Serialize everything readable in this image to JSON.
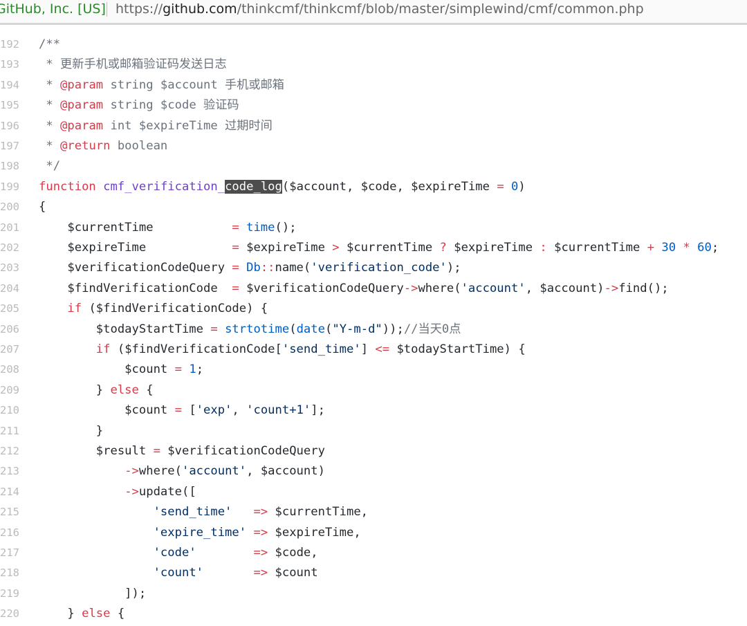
{
  "browser": {
    "site_identity": "GitHub, Inc. [US]",
    "url_scheme": "https://",
    "url_host": "github.com",
    "url_path": "/thinkcmf/thinkcmf/blob/master/simplewind/cmf/common.php"
  },
  "code": {
    "highlighted_text": "code_log",
    "lines": [
      {
        "n": "192",
        "tokens": [
          {
            "t": "/**",
            "c": "c"
          }
        ]
      },
      {
        "n": "193",
        "tokens": [
          {
            "t": " * 更新手机或邮箱验证码发送日志",
            "c": "c"
          }
        ]
      },
      {
        "n": "194",
        "tokens": [
          {
            "t": " * ",
            "c": "c"
          },
          {
            "t": "@param",
            "c": "k"
          },
          {
            "t": " string $account 手机或邮箱",
            "c": "c"
          }
        ]
      },
      {
        "n": "195",
        "tokens": [
          {
            "t": " * ",
            "c": "c"
          },
          {
            "t": "@param",
            "c": "k"
          },
          {
            "t": " string $code 验证码",
            "c": "c"
          }
        ]
      },
      {
        "n": "196",
        "tokens": [
          {
            "t": " * ",
            "c": "c"
          },
          {
            "t": "@param",
            "c": "k"
          },
          {
            "t": " int $expireTime 过期时间",
            "c": "c"
          }
        ]
      },
      {
        "n": "197",
        "tokens": [
          {
            "t": " * ",
            "c": "c"
          },
          {
            "t": "@return",
            "c": "k"
          },
          {
            "t": " boolean",
            "c": "c"
          }
        ]
      },
      {
        "n": "198",
        "tokens": [
          {
            "t": " */",
            "c": "c"
          }
        ]
      },
      {
        "n": "199",
        "tokens": [
          {
            "t": "function",
            "c": "k"
          },
          {
            "t": " "
          },
          {
            "t": "cmf_verification_",
            "c": "f"
          },
          {
            "t": "code_log",
            "c": "hl"
          },
          {
            "t": "($account, $code, $expireTime "
          },
          {
            "t": "=",
            "c": "k"
          },
          {
            "t": " "
          },
          {
            "t": "0",
            "c": "e"
          },
          {
            "t": ")"
          }
        ]
      },
      {
        "n": "200",
        "tokens": [
          {
            "t": "{"
          }
        ]
      },
      {
        "n": "201",
        "tokens": [
          {
            "t": "    $currentTime           "
          },
          {
            "t": "=",
            "c": "k"
          },
          {
            "t": " "
          },
          {
            "t": "time",
            "c": "e"
          },
          {
            "t": "();"
          }
        ]
      },
      {
        "n": "202",
        "tokens": [
          {
            "t": "    $expireTime            "
          },
          {
            "t": "=",
            "c": "k"
          },
          {
            "t": " $expireTime "
          },
          {
            "t": ">",
            "c": "k"
          },
          {
            "t": " $currentTime "
          },
          {
            "t": "?",
            "c": "k"
          },
          {
            "t": " $expireTime "
          },
          {
            "t": ":",
            "c": "k"
          },
          {
            "t": " $currentTime "
          },
          {
            "t": "+",
            "c": "k"
          },
          {
            "t": " "
          },
          {
            "t": "30",
            "c": "e"
          },
          {
            "t": " "
          },
          {
            "t": "*",
            "c": "k"
          },
          {
            "t": " "
          },
          {
            "t": "60",
            "c": "e"
          },
          {
            "t": ";"
          }
        ]
      },
      {
        "n": "203",
        "tokens": [
          {
            "t": "    $verificationCodeQuery "
          },
          {
            "t": "=",
            "c": "k"
          },
          {
            "t": " "
          },
          {
            "t": "Db",
            "c": "e"
          },
          {
            "t": "::",
            "c": "k"
          },
          {
            "t": "name("
          },
          {
            "t": "'verification_code'",
            "c": "s"
          },
          {
            "t": ");"
          }
        ]
      },
      {
        "n": "204",
        "tokens": [
          {
            "t": "    $findVerificationCode  "
          },
          {
            "t": "=",
            "c": "k"
          },
          {
            "t": " $verificationCodeQuery"
          },
          {
            "t": "->",
            "c": "k"
          },
          {
            "t": "where("
          },
          {
            "t": "'account'",
            "c": "s"
          },
          {
            "t": ", $account)"
          },
          {
            "t": "->",
            "c": "k"
          },
          {
            "t": "find();"
          }
        ]
      },
      {
        "n": "205",
        "tokens": [
          {
            "t": "    "
          },
          {
            "t": "if",
            "c": "k"
          },
          {
            "t": " ($findVerificationCode) {"
          }
        ]
      },
      {
        "n": "206",
        "tokens": [
          {
            "t": "        $todayStartTime "
          },
          {
            "t": "=",
            "c": "k"
          },
          {
            "t": " "
          },
          {
            "t": "strtotime",
            "c": "e"
          },
          {
            "t": "("
          },
          {
            "t": "date",
            "c": "e"
          },
          {
            "t": "("
          },
          {
            "t": "\"Y-m-d\"",
            "c": "s"
          },
          {
            "t": "));"
          },
          {
            "t": "//当天0点",
            "c": "c"
          }
        ]
      },
      {
        "n": "207",
        "tokens": [
          {
            "t": "        "
          },
          {
            "t": "if",
            "c": "k"
          },
          {
            "t": " ($findVerificationCode["
          },
          {
            "t": "'send_time'",
            "c": "s"
          },
          {
            "t": "] "
          },
          {
            "t": "<=",
            "c": "k"
          },
          {
            "t": " $todayStartTime) {"
          }
        ]
      },
      {
        "n": "208",
        "tokens": [
          {
            "t": "            $count "
          },
          {
            "t": "=",
            "c": "k"
          },
          {
            "t": " "
          },
          {
            "t": "1",
            "c": "e"
          },
          {
            "t": ";"
          }
        ]
      },
      {
        "n": "209",
        "tokens": [
          {
            "t": "        } "
          },
          {
            "t": "else",
            "c": "k"
          },
          {
            "t": " {"
          }
        ]
      },
      {
        "n": "210",
        "tokens": [
          {
            "t": "            $count "
          },
          {
            "t": "=",
            "c": "k"
          },
          {
            "t": " ["
          },
          {
            "t": "'exp'",
            "c": "s"
          },
          {
            "t": ", "
          },
          {
            "t": "'count+1'",
            "c": "s"
          },
          {
            "t": "];"
          }
        ]
      },
      {
        "n": "211",
        "tokens": [
          {
            "t": "        }"
          }
        ]
      },
      {
        "n": "212",
        "tokens": [
          {
            "t": "        $result "
          },
          {
            "t": "=",
            "c": "k"
          },
          {
            "t": " $verificationCodeQuery"
          }
        ]
      },
      {
        "n": "213",
        "tokens": [
          {
            "t": "            "
          },
          {
            "t": "->",
            "c": "k"
          },
          {
            "t": "where("
          },
          {
            "t": "'account'",
            "c": "s"
          },
          {
            "t": ", $account)"
          }
        ]
      },
      {
        "n": "214",
        "tokens": [
          {
            "t": "            "
          },
          {
            "t": "->",
            "c": "k"
          },
          {
            "t": "update(["
          }
        ]
      },
      {
        "n": "215",
        "tokens": [
          {
            "t": "                "
          },
          {
            "t": "'send_time'",
            "c": "s"
          },
          {
            "t": "   "
          },
          {
            "t": "=>",
            "c": "k"
          },
          {
            "t": " $currentTime,"
          }
        ]
      },
      {
        "n": "216",
        "tokens": [
          {
            "t": "                "
          },
          {
            "t": "'expire_time'",
            "c": "s"
          },
          {
            "t": " "
          },
          {
            "t": "=>",
            "c": "k"
          },
          {
            "t": " $expireTime,"
          }
        ]
      },
      {
        "n": "217",
        "tokens": [
          {
            "t": "                "
          },
          {
            "t": "'code'",
            "c": "s"
          },
          {
            "t": "        "
          },
          {
            "t": "=>",
            "c": "k"
          },
          {
            "t": " $code,"
          }
        ]
      },
      {
        "n": "218",
        "tokens": [
          {
            "t": "                "
          },
          {
            "t": "'count'",
            "c": "s"
          },
          {
            "t": "       "
          },
          {
            "t": "=>",
            "c": "k"
          },
          {
            "t": " $count"
          }
        ]
      },
      {
        "n": "219",
        "tokens": [
          {
            "t": "            ]);"
          }
        ]
      },
      {
        "n": "220",
        "tokens": [
          {
            "t": "    } "
          },
          {
            "t": "else",
            "c": "k"
          },
          {
            "t": " {"
          }
        ]
      }
    ]
  }
}
